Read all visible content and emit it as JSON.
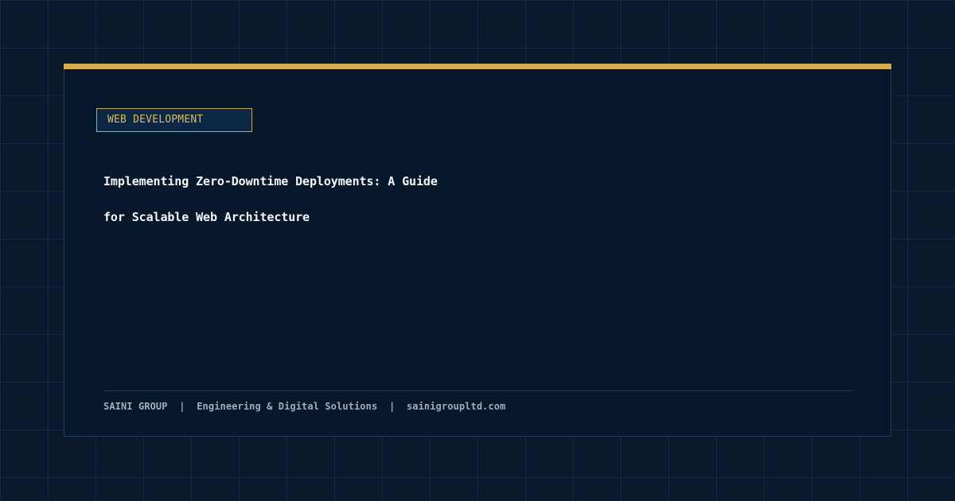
{
  "card": {
    "category": "WEB DEVELOPMENT",
    "title": "Implementing Zero-Downtime Deployments: A Guide for Scalable Web Architecture"
  },
  "footer": {
    "company": "SAINI GROUP",
    "separator": "|",
    "tagline": "Engineering & Digital Solutions",
    "website": "sainigroupltd.com"
  },
  "colors": {
    "background": "#0b1a2d",
    "card": "#07182c",
    "accent": "#d6ad4c",
    "title": "#f4f6fa",
    "footer_text": "#9aaec4"
  }
}
